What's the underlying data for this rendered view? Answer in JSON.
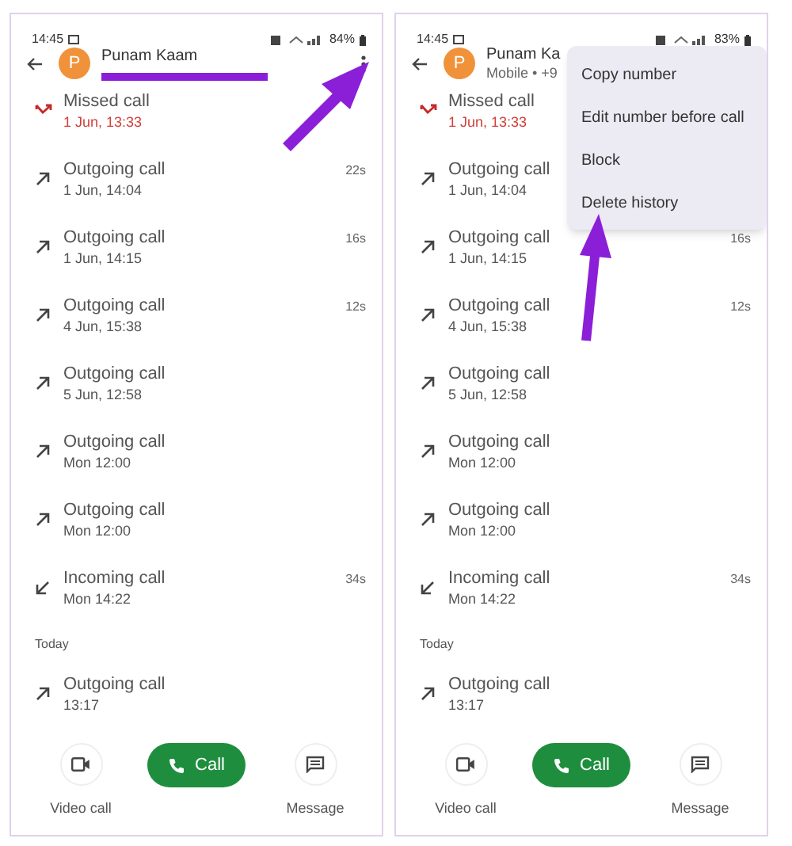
{
  "screens": [
    {
      "status_bar": {
        "time": "14:45",
        "battery": "84%"
      },
      "contact": {
        "initial": "P",
        "name": "Punam Kaam",
        "number_redacted": true
      },
      "annotation_arrow": true,
      "calls": [
        {
          "kind": "missed",
          "title": "Missed call",
          "time": "1 Jun, 13:33"
        },
        {
          "kind": "outgoing",
          "title": "Outgoing call",
          "time": "1 Jun, 14:04",
          "duration": "22s"
        },
        {
          "kind": "outgoing",
          "title": "Outgoing call",
          "time": "1 Jun, 14:15",
          "duration": "16s"
        },
        {
          "kind": "outgoing",
          "title": "Outgoing call",
          "time": "4 Jun, 15:38",
          "duration": "12s"
        },
        {
          "kind": "outgoing",
          "title": "Outgoing call",
          "time": "5 Jun, 12:58"
        },
        {
          "kind": "outgoing",
          "title": "Outgoing call",
          "time": "Mon 12:00"
        },
        {
          "kind": "outgoing",
          "title": "Outgoing call",
          "time": "Mon 12:00"
        },
        {
          "kind": "incoming",
          "title": "Incoming call",
          "time": "Mon 14:22",
          "duration": "34s"
        },
        {
          "kind": "section",
          "title": "Today"
        },
        {
          "kind": "outgoing",
          "title": "Outgoing call",
          "time": "13:17"
        }
      ],
      "actions": [
        {
          "kind": "video",
          "label": "Video call"
        },
        {
          "kind": "call",
          "label": "Call"
        },
        {
          "kind": "message",
          "label": "Message"
        }
      ]
    },
    {
      "status_bar": {
        "time": "14:45",
        "battery": "83%"
      },
      "contact": {
        "initial": "P",
        "name": "Punam Ka",
        "subtitle": "Mobile • +9",
        "number_redacted": false
      },
      "annotation_arrow": true,
      "menu": [
        "Copy number",
        "Edit number before call",
        "Block",
        "Delete history"
      ],
      "calls": [
        {
          "kind": "missed",
          "title": "Missed call",
          "time": "1 Jun, 13:33"
        },
        {
          "kind": "outgoing",
          "title": "Outgoing call",
          "time": "1 Jun, 14:04"
        },
        {
          "kind": "outgoing",
          "title": "Outgoing call",
          "time": "1 Jun, 14:15",
          "duration": "16s"
        },
        {
          "kind": "outgoing",
          "title": "Outgoing call",
          "time": "4 Jun, 15:38",
          "duration": "12s"
        },
        {
          "kind": "outgoing",
          "title": "Outgoing call",
          "time": "5 Jun, 12:58"
        },
        {
          "kind": "outgoing",
          "title": "Outgoing call",
          "time": "Mon 12:00"
        },
        {
          "kind": "outgoing",
          "title": "Outgoing call",
          "time": "Mon 12:00"
        },
        {
          "kind": "incoming",
          "title": "Incoming call",
          "time": "Mon 14:22",
          "duration": "34s"
        },
        {
          "kind": "section",
          "title": "Today"
        },
        {
          "kind": "outgoing",
          "title": "Outgoing call",
          "time": "13:17"
        }
      ],
      "actions": [
        {
          "kind": "video",
          "label": "Video call"
        },
        {
          "kind": "call",
          "label": "Call"
        },
        {
          "kind": "message",
          "label": "Message"
        }
      ]
    }
  ]
}
